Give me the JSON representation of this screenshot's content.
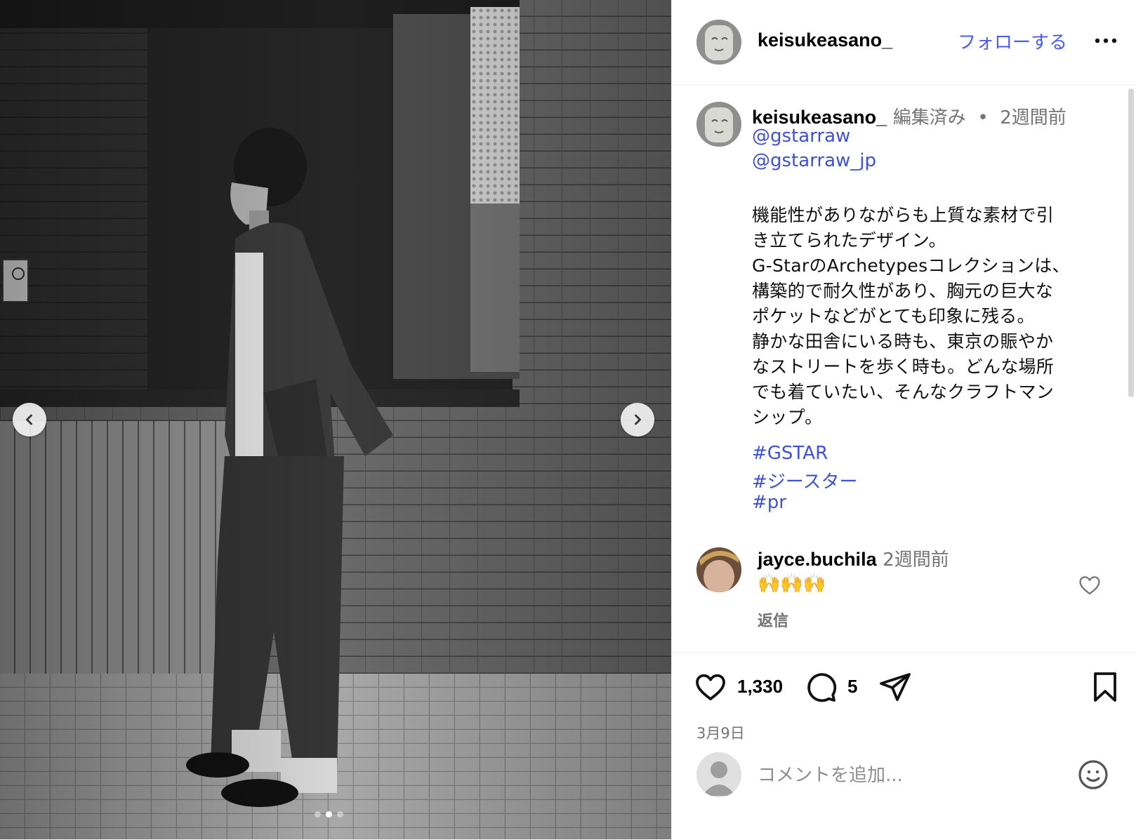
{
  "post": {
    "username": "keisukeasano_",
    "follow_label": "フォローする",
    "more_icon": "more-horizontal-icon"
  },
  "caption": {
    "username": "keisukeasano_",
    "edited": "編集済み",
    "separator": "•",
    "time": "2週間前",
    "mentions": [
      "@gstarraw",
      "@gstarraw_jp"
    ],
    "body": "機能性がありながらも上質な素材で引\nき立てられたデザイン。\nG-StarのArchetypesコレクションは、\n構築的で耐久性があり、胸元の巨大な\nポケットなどがとても印象に残る。\n静かな田舎にいる時も、東京の賑やか\nなストリートを歩く時も。どんな場所\nでも着ていたい、そんなクラフトマン\nシップ。",
    "hashtags": [
      "#GSTAR",
      "#ジースター",
      "#pr"
    ]
  },
  "comments": [
    {
      "username": "jayce.buchila",
      "time": "2週間前",
      "text": "🙌🙌🙌",
      "reply_label": "返信"
    }
  ],
  "actions": {
    "likes": "1,330",
    "comments_count": "5",
    "date": "3月9日"
  },
  "add_comment": {
    "placeholder": "コメントを追加..."
  },
  "carousel": {
    "total_slides": 3,
    "active_slide": 2
  },
  "colors": {
    "accent_blue": "#4a5cf0",
    "link_blue": "#3f51d6",
    "muted_gray": "#737373"
  }
}
